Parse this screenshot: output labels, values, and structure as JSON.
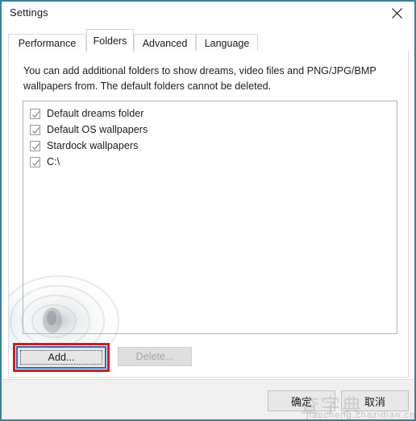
{
  "window": {
    "title": "Settings",
    "close_icon": "close-icon",
    "border_color": "#3d7f96"
  },
  "tabs": [
    {
      "label": "Performance",
      "selected": false
    },
    {
      "label": "Folders",
      "selected": true
    },
    {
      "label": "Advanced",
      "selected": false
    },
    {
      "label": "Language",
      "selected": false
    }
  ],
  "panel": {
    "description": "You can add additional folders to show dreams, video files and PNG/JPG/BMP wallpapers from.  The default folders cannot be deleted.",
    "folders": [
      {
        "label": "Default dreams folder",
        "checked": true
      },
      {
        "label": "Default OS wallpapers",
        "checked": true
      },
      {
        "label": "Stardock wallpapers",
        "checked": true
      },
      {
        "label": "C:\\",
        "checked": true
      }
    ]
  },
  "buttons": {
    "add_label": "Add...",
    "delete_label": "Delete...",
    "delete_enabled": false,
    "ok_label": "确定",
    "cancel_label": "取消"
  },
  "annotation": {
    "highlight_color": "#e11515",
    "focus_color": "#1b6fc4"
  },
  "watermark": {
    "cn": "查字典",
    "en": "jiaocheng.chazidian.com"
  }
}
